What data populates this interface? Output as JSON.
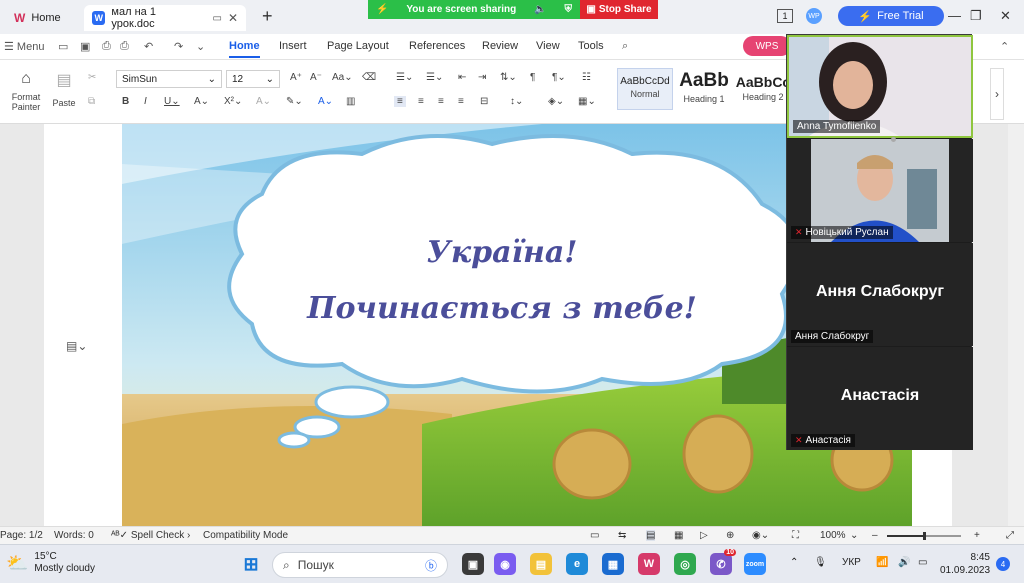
{
  "titlebar": {
    "home_tab": "Home",
    "doc_tab": "мал на 1 урок.doc",
    "share_text": "You are screen sharing",
    "stop_share": "Stop Share",
    "free_trial": "Free Trial",
    "count_badge": "1"
  },
  "menu": {
    "menu_label": "Menu",
    "items": [
      "Home",
      "Insert",
      "Page Layout",
      "References",
      "Review",
      "View",
      "Tools"
    ],
    "wps_pill": "WPS"
  },
  "ribbon": {
    "format_painter": "Format Painter",
    "paste": "Paste",
    "font_name": "SimSun",
    "font_size": "12",
    "styles": [
      {
        "preview": "AaBbCcDd",
        "name": "Normal"
      },
      {
        "preview": "AaBb",
        "name": "Heading 1"
      },
      {
        "preview": "AaBbCc",
        "name": "Heading 2"
      }
    ]
  },
  "document": {
    "line1": "Україна!",
    "line2": "Починається з тебе!"
  },
  "participants": [
    {
      "name": "Anna Tymofiienko",
      "video": true,
      "muted": false
    },
    {
      "name": "Новіцький Руслан",
      "video": true,
      "muted": true
    },
    {
      "name": "Ання Слабокруг",
      "display": "Ання Слабокруг",
      "video": false,
      "muted": false
    },
    {
      "name": "Анастасія",
      "display": "Анастасія",
      "video": false,
      "muted": true
    }
  ],
  "statusbar": {
    "page": "Page: 1/2",
    "words": "Words: 0",
    "spell_check": "Spell Check",
    "compat": "Compatibility Mode",
    "zoom": "100%",
    "zoom_level": 0.5
  },
  "taskbar": {
    "temp": "15°C",
    "weather": "Mostly cloudy",
    "search": "Пошук",
    "lang": "УКР",
    "time": "8:45",
    "date": "01.09.2023",
    "notifications": "4",
    "badge_app": "10"
  }
}
